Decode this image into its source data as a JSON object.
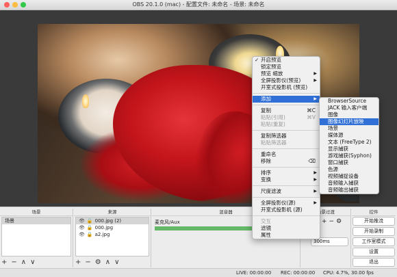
{
  "window": {
    "title": "OBS 20.1.0 (mac) - 配置文件: 未命名 - 场景: 未命名",
    "colors": {
      "close": "#fc615d",
      "minimize": "#fdbc40",
      "zoom": "#34c84a"
    }
  },
  "context_menu": {
    "items": [
      {
        "label": "开启预览",
        "checked": true
      },
      {
        "label": "锁定预览"
      },
      {
        "label": "预览 缩放",
        "submenu": true
      },
      {
        "label": "全屏投影仪(预览)",
        "submenu": true
      },
      {
        "label": "开室式投影机 (预览)"
      },
      {
        "separator": true
      },
      {
        "label": "添加",
        "submenu": true,
        "highlighted": true
      },
      {
        "separator": true
      },
      {
        "label": "复制",
        "shortcut": "⌘C"
      },
      {
        "label": "粘贴(引用)",
        "shortcut": "⌘V",
        "disabled": true
      },
      {
        "label": "粘贴(重复)",
        "disabled": true
      },
      {
        "separator": true
      },
      {
        "label": "复制筛选器"
      },
      {
        "label": "粘贴筛选器",
        "disabled": true
      },
      {
        "separator": true
      },
      {
        "label": "重命名"
      },
      {
        "label": "移除",
        "shortcut": "⌫"
      },
      {
        "separator": true
      },
      {
        "label": "排序",
        "submenu": true
      },
      {
        "label": "变换",
        "submenu": true
      },
      {
        "separator": true
      },
      {
        "label": "尺度滤波",
        "submenu": true
      },
      {
        "separator": true
      },
      {
        "label": "全屏投影仪(源)",
        "submenu": true
      },
      {
        "label": "开室式投影机 (源)"
      },
      {
        "separator": true
      },
      {
        "label": "交互",
        "disabled": true
      },
      {
        "label": "滤镜"
      },
      {
        "label": "属性"
      }
    ]
  },
  "add_submenu": {
    "items": [
      {
        "label": "BrowserSource"
      },
      {
        "label": "JACK 输入客户端"
      },
      {
        "label": "图像"
      },
      {
        "label": "图像幻灯片放映",
        "highlighted": true
      },
      {
        "label": "场景"
      },
      {
        "label": "媒体源"
      },
      {
        "label": "文本 (FreeType 2)"
      },
      {
        "label": "显示捕获"
      },
      {
        "label": "游戏捕获(Syphon)"
      },
      {
        "label": "窗口捕获"
      },
      {
        "label": "色源"
      },
      {
        "label": "视频捕捉设备"
      },
      {
        "label": "音频输入捕获"
      },
      {
        "label": "音频输出捕获"
      }
    ]
  },
  "docks": {
    "scenes": {
      "header": "场景",
      "items": [
        "场景"
      ]
    },
    "sources": {
      "header": "来源",
      "items": [
        "000.jpg (2)",
        "000.jpg",
        "a2.jpg"
      ]
    },
    "mixer": {
      "header": "混音器",
      "channel": "麦克风/Aux"
    },
    "transitions": {
      "header": "场景过渡",
      "duration": "300ms"
    },
    "controls": {
      "header": "控件",
      "buttons": [
        "开始推流",
        "开始录制",
        "工作室模式",
        "设置",
        "退出"
      ]
    },
    "tool_icons": {
      "add": "+",
      "remove": "−",
      "settings": "⚙",
      "up": "∧",
      "down": "∨"
    }
  },
  "status": {
    "live": "LIVE: 00:00:00",
    "rec": "REC: 00:00:00",
    "cpu": "CPU: 4.7%, 30.00 fps"
  }
}
